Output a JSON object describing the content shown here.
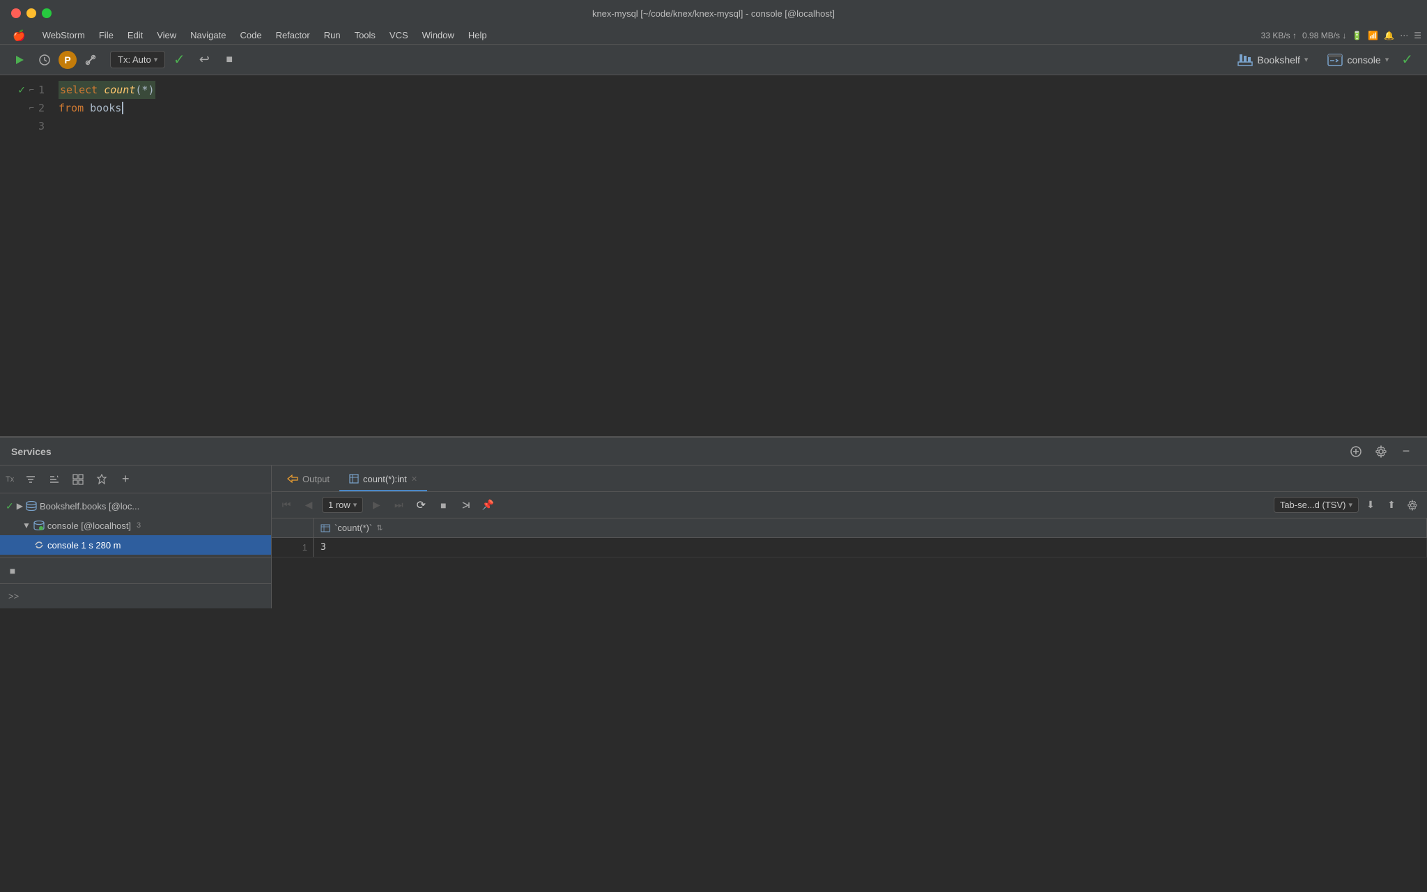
{
  "titlebar": {
    "title": "knex-mysql [~/code/knex/knex-mysql] - console [@localhost]",
    "traffic": [
      "close",
      "minimize",
      "maximize"
    ]
  },
  "menubar": {
    "apple": "🍎",
    "items": [
      "WebStorm",
      "File",
      "Edit",
      "View",
      "Navigate",
      "Code",
      "Refactor",
      "Run",
      "Tools",
      "VCS",
      "Window",
      "Help"
    ],
    "right": {
      "network": "33 KB/s ↑",
      "network2": "0.98 MB/s ↓",
      "battery": "🔋",
      "wifi": "WiFi",
      "time": ""
    }
  },
  "toolbar": {
    "run_label": "▶",
    "history_label": "⏱",
    "commit_label": "P",
    "settings_label": "🔧",
    "tx_label": "Tx: Auto",
    "check_label": "✓",
    "undo_label": "↩",
    "stop_label": "■",
    "bookshelf_label": "Bookshelf",
    "console_label": "console",
    "check_right_label": "✓"
  },
  "editor": {
    "lines": [
      {
        "num": "1",
        "show_check": true,
        "show_fold": true,
        "code": "select count(*)",
        "parts": [
          {
            "text": "select ",
            "class": "kw-orange"
          },
          {
            "text": "count",
            "class": "fn-italic"
          },
          {
            "text": "(",
            "class": "paren"
          },
          {
            "text": "*",
            "class": "star"
          },
          {
            "text": ")",
            "class": "paren"
          }
        ]
      },
      {
        "num": "2",
        "show_check": false,
        "show_fold": true,
        "code": "from books",
        "parts": [
          {
            "text": "from ",
            "class": "kw-orange"
          },
          {
            "text": "books",
            "class": "text-white"
          }
        ]
      },
      {
        "num": "3",
        "show_check": false,
        "show_fold": false,
        "code": "",
        "parts": []
      }
    ]
  },
  "services": {
    "title": "Services",
    "toolbar_label": "Tx",
    "tree_items": [
      {
        "id": "bookshelf-books",
        "label": "Bookshelf.books [@loc...",
        "indent": 0,
        "has_check": true,
        "has_arrow": true,
        "collapsed": false,
        "icon": "db"
      },
      {
        "id": "console",
        "label": "console [@localhost]",
        "indent": 1,
        "has_check": false,
        "has_arrow": true,
        "collapsed": false,
        "icon": "console",
        "badge": "3"
      },
      {
        "id": "console-session",
        "label": "console  1 s  280 m",
        "indent": 2,
        "has_check": false,
        "has_arrow": false,
        "icon": "session",
        "selected": true
      }
    ]
  },
  "output_tabs": [
    {
      "id": "output",
      "label": "Output",
      "icon": "output",
      "active": false,
      "closeable": false
    },
    {
      "id": "count-int",
      "label": "count(*):int",
      "icon": "table",
      "active": true,
      "closeable": true
    }
  ],
  "data_toolbar": {
    "first_label": "⏮",
    "prev_label": "◀",
    "rows_label": "1 row",
    "next_label": "▶",
    "last_label": "⏭",
    "refresh_label": "⟳",
    "stop_label": "■",
    "pin_label": "📌",
    "unpin_label": "↗",
    "tsv_label": "Tab-se...d (TSV)",
    "download_label": "⬇",
    "upload_label": "⬆",
    "settings_label": "⚙"
  },
  "data_grid": {
    "columns": [
      {
        "id": "row-num",
        "label": ""
      },
      {
        "id": "count-star",
        "label": "`count(*)`",
        "icon": "int"
      }
    ],
    "rows": [
      {
        "row_num": "1",
        "count_star": "3"
      }
    ]
  },
  "colors": {
    "bg_dark": "#2b2b2b",
    "bg_medium": "#3c3f41",
    "accent_blue": "#4a88c7",
    "accent_green": "#4caf50",
    "accent_orange": "#cc7832",
    "selected_blue": "#2e5e9e"
  }
}
